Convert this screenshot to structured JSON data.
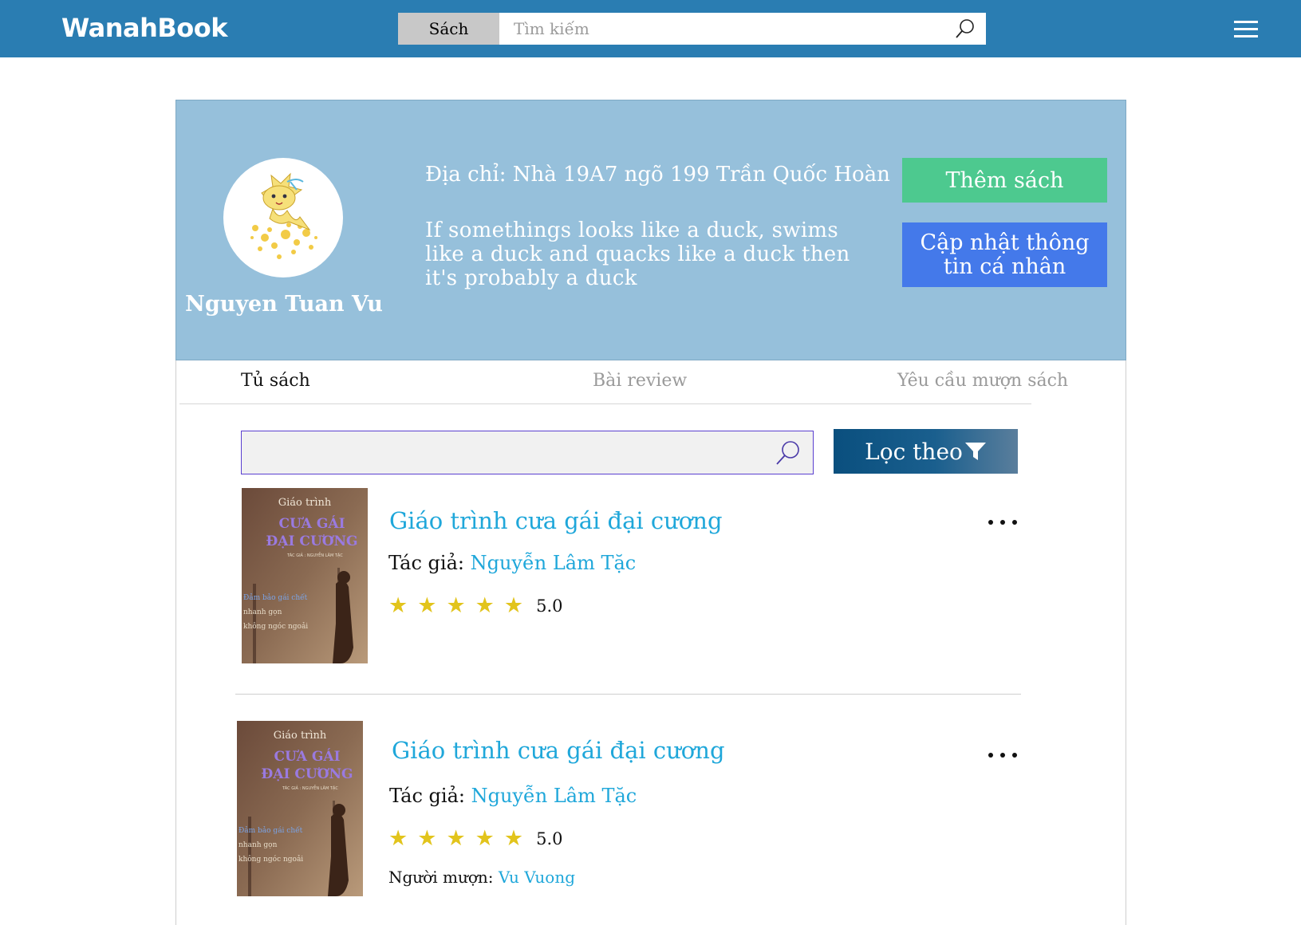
{
  "header": {
    "logo": "WanahBook",
    "search_category": "Sách",
    "search_placeholder": "Tìm kiếm",
    "icons": {
      "search": "search-icon",
      "menu": "hamburger-menu-icon"
    }
  },
  "profile": {
    "name": "Nguyen Tuan Vu",
    "address": "Địa chỉ: Nhà 19A7 ngõ 199 Trần Quốc Hoàn",
    "bio": "If somethings looks like a duck, swims like a duck and quacks like a duck then it's probably a duck",
    "add_book_label": "Thêm sách",
    "update_info_label": "Cập nhật thông tin cá nhân"
  },
  "tabs": [
    {
      "label": "Tủ sách",
      "active": true
    },
    {
      "label": "Bài review",
      "active": false
    },
    {
      "label": "Yêu cầu mượn sách",
      "active": false
    }
  ],
  "shelf": {
    "search_value": "",
    "filter_label": "Lọc theo"
  },
  "books": [
    {
      "title": "Giáo trình cưa gái đại cương",
      "author_label": "Tác giả:",
      "author": "Nguyễn Lâm Tặc",
      "rating": "5.0",
      "stars": 5,
      "cover": {
        "line1": "Giáo trình",
        "line2": "CƯA GÁI",
        "line3": "ĐẠI CƯƠNG",
        "line4": "TÁC GIẢ : NGUYỄN LÂM TẶC",
        "tag1": "Đảm bảo gái chết",
        "tag2": "nhanh gọn",
        "tag3": "không ngóc ngoải"
      }
    },
    {
      "title": "Giáo trình cưa gái đại cương",
      "author_label": "Tác giả:",
      "author": "Nguyễn Lâm Tặc",
      "rating": "5.0",
      "stars": 5,
      "borrower_label": "Người mượn:",
      "borrower": "Vu Vuong",
      "cover": {
        "line1": "Giáo trình",
        "line2": "CƯA GÁI",
        "line3": "ĐẠI CƯƠNG",
        "line4": "TÁC GIẢ : NGUYỄN LÂM TẶC",
        "tag1": "Đảm bảo gái chết",
        "tag2": "nhanh gọn",
        "tag3": "không ngóc ngoải"
      }
    }
  ],
  "colors": {
    "topbar": "#2a7db2",
    "profile_bg": "#96c0db",
    "add_button": "#4dc98f",
    "update_button": "#4479ea",
    "link": "#1fa7da",
    "star": "#e2c41c"
  }
}
